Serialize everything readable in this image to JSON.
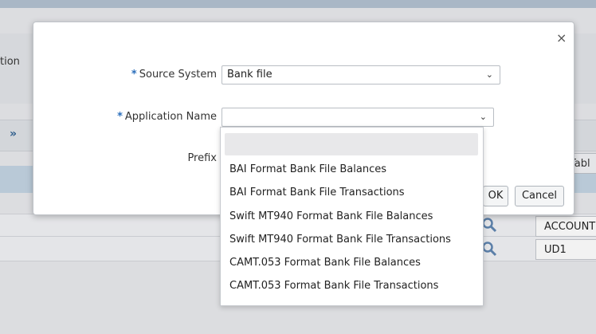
{
  "background": {
    "left_label": "tion",
    "chevron": "»",
    "table_header": "Tabl",
    "cells": [
      "ACCOUNT",
      "UD1"
    ]
  },
  "dialog": {
    "close": "×",
    "fields": {
      "source_system": {
        "required_mark": "*",
        "label": "Source System",
        "value": "Bank file"
      },
      "application_name": {
        "required_mark": "*",
        "label": "Application Name",
        "value": ""
      },
      "prefix": {
        "label": "Prefix"
      }
    },
    "buttons": {
      "ok": "OK",
      "cancel": "Cancel"
    },
    "chevron_glyph": "⌄"
  },
  "dropdown": {
    "options": [
      "",
      "BAI Format Bank File Balances",
      "BAI Format Bank File Transactions",
      "Swift MT940 Format Bank File Balances",
      "Swift MT940 Format Bank File Transactions",
      "CAMT.053 Format Bank File Balances",
      "CAMT.053 Format Bank File Transactions"
    ]
  },
  "colors": {
    "required": "#2a6ebb",
    "search_icon": "#5b7fa8"
  }
}
